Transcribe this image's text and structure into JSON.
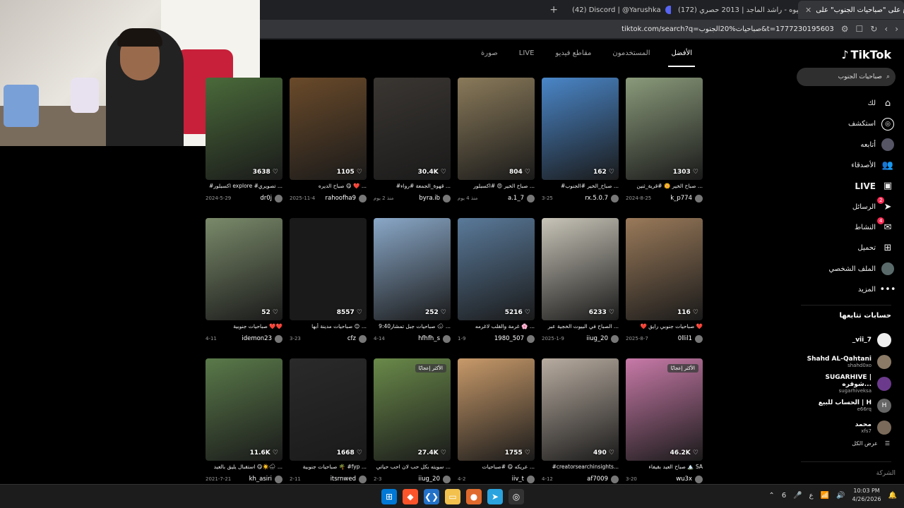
{
  "browser": {
    "tabs": [
      {
        "label": "اطلع على \"صباحيات الجنوب\" على",
        "icon": "tiktok-icon",
        "active": true
      },
      {
        "label": "(172) غيوه - راشد الماجد | 2013 حصري",
        "icon": "youtube-icon",
        "active": false
      },
      {
        "label": "(42) Discord | @Yarushka",
        "icon": "discord-icon",
        "active": false
      }
    ],
    "new_tab": "+",
    "url": "tiktok.com/search?q=صباحيات%20الجنوب&t=1777230195603"
  },
  "tiktok": {
    "logo": "TikTok",
    "search_placeholder": "صباحيات الجنوب",
    "menu": [
      {
        "label": "لك",
        "icon": "home-icon"
      },
      {
        "label": "استكشف",
        "icon": "compass-icon"
      },
      {
        "label": "أتابعه",
        "icon": "avatar-icon"
      },
      {
        "label": "الأصدقاء",
        "icon": "friends-icon"
      },
      {
        "label": "LIVE",
        "icon": "live-icon"
      },
      {
        "label": "الرسائل",
        "icon": "send-icon",
        "badge": "2"
      },
      {
        "label": "النشاط",
        "icon": "message-icon",
        "badge": "4"
      },
      {
        "label": "تحميل",
        "icon": "upload-icon"
      },
      {
        "label": "الملف الشخصي",
        "icon": "profile-icon"
      },
      {
        "label": "المزيد",
        "icon": "more-icon"
      }
    ],
    "following_title": "حسابات تتابعها",
    "following": [
      {
        "name": "_vii_7",
        "handle": "",
        "avatar_color": "#eeeeee"
      },
      {
        "name": "Shahd AL-Qahtani",
        "handle": "shahd0xo",
        "avatar_color": "#8a7a66"
      },
      {
        "name": "SUGARHIVE | شوقره...",
        "handle": "sugarhiveksa",
        "avatar_color": "#6b3a8c"
      },
      {
        "name": "الحساب للبيع | H",
        "handle": "e66rq",
        "avatar_color": "#666666",
        "initial": "H"
      },
      {
        "name": "محمد",
        "handle": "xfs7",
        "avatar_color": "#7a6a5a"
      }
    ],
    "see_all": "عرض الكل",
    "company": "الشركة",
    "tabs": [
      "الأفضل",
      "المستخدمون",
      "مقاطع فيديو",
      "LIVE",
      "صورة"
    ],
    "active_tab": "الأفضل",
    "videos": [
      {
        "likes": "1303",
        "caption": "صباح الخير 🌼 #قرية_ثنين ...",
        "user": "k_p774",
        "date": "2024-8-25",
        "color": "#8a9a7a"
      },
      {
        "likes": "162",
        "caption": "#صباح_الخير #الجنوب ...",
        "user": "rx.5.0.7",
        "date": "3-25",
        "color": "#4a86c8"
      },
      {
        "likes": "804",
        "caption": "صباح الخير 😍 #اكسبلور ...",
        "user": "a.1_7",
        "date": "منذ 4 يوم",
        "color": "#8a7a5a"
      },
      {
        "likes": "30.4K",
        "caption": "#قهوة_الجمعة #رواء ...",
        "user": "byra.ib",
        "date": "منذ 2 يوم",
        "color": "#3a3632"
      },
      {
        "likes": "1105",
        "caption": "صباح الديره 😋 ❤️ ...",
        "user": "rahoofha9",
        "date": "2025-11-4",
        "color": "#6a4a2a"
      },
      {
        "likes": "3638",
        "caption": "#اكسبلور explore #تصويري ...",
        "user": "dr0j",
        "date": "2024-5-29",
        "color": "#4a6a3a"
      },
      {
        "likes": "116",
        "caption": "❤️ صباحيات جنوبي رايق ❤️",
        "user": "0llil1",
        "date": "2025-8-7",
        "color": "#9a7a5a"
      },
      {
        "likes": "6233",
        "caption": "الصباح في البيوت الخجية عبر ...",
        "user": "iiug_20",
        "date": "2025-1-9",
        "color": "#c8c4b8"
      },
      {
        "likes": "5216",
        "caption": "غرمة والقلب لاغرمه 🌸 ...",
        "user": "1980_507",
        "date": "1-9",
        "color": "#5a7a9a"
      },
      {
        "likes": "252",
        "caption": "صباحيات جبل تمشار9:40 🌧 ...",
        "user": "hfhfh_s",
        "date": "4-14",
        "color": "#8aa8c8"
      },
      {
        "likes": "8557",
        "caption": "صباحيات مدينة أبها 😊 ...",
        "user": "cfz",
        "date": "3-23",
        "color": "#1a1a1a"
      },
      {
        "likes": "52",
        "caption": "صباحيات جنوبية ❤️❤️",
        "user": "idemon23",
        "date": "4-11",
        "color": "#7a8a6a"
      },
      {
        "likes": "46.2K",
        "caption": "صباح العيد بقيفاء 🏔️ SA",
        "user": "wu3x",
        "date": "3-20",
        "color": "#c87aa8",
        "top_tag": "الأكثر إعجابًا"
      },
      {
        "likes": "490",
        "caption": "#creatorsearchinsights...",
        "user": "af7009",
        "date": "4-12",
        "color": "#b8aca0"
      },
      {
        "likes": "1755",
        "caption": "عريكه 😋 #صباحيات ...",
        "user": "iiv_t",
        "date": "4-2",
        "color": "#c89a6a"
      },
      {
        "likes": "27.4K",
        "caption": "سويته بكل حب لان احب حياتي ...",
        "user": "iiug_20",
        "date": "2-3",
        "color": "#6a8a4a",
        "top_tag": "الأكثر إعجابًا"
      },
      {
        "likes": "1668",
        "caption": "صباحيات جنوبية 🌴 #fyp ...",
        "user": "itsrnwed",
        "date": "2-11",
        "color": "#2a2a2a"
      },
      {
        "likes": "11.6K",
        "caption": "استقبال يليق بالعيد 😋☀️🌧 ...",
        "user": "kh_asiri",
        "date": "2021-7-21",
        "color": "#5a7a4a"
      }
    ]
  },
  "taskbar": {
    "time": "10:03 PM",
    "date": "4/26/2026",
    "lang": "ع",
    "num": "6"
  },
  "colors": {
    "accent": "#fe2c55",
    "background": "#000000",
    "browser_chrome": "#202124"
  }
}
